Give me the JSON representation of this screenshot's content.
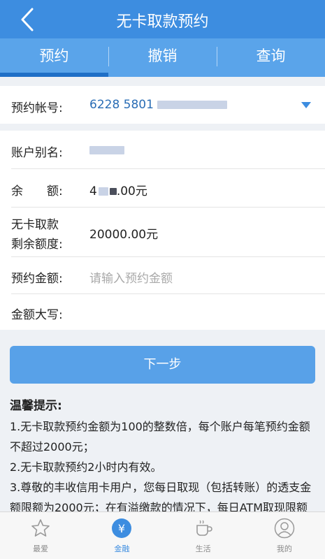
{
  "header": {
    "title": "无卡取款预约",
    "back_icon": "chevron-left-icon"
  },
  "tabs": [
    {
      "label": "预约",
      "active": true
    },
    {
      "label": "撤销",
      "active": false
    },
    {
      "label": "查询",
      "active": false
    }
  ],
  "form": {
    "account": {
      "label": "预约帐号:",
      "value": "6228 5801"
    },
    "alias": {
      "label": "账户别名:"
    },
    "balance": {
      "label": "余　　额:",
      "value_prefix": "4",
      "value_suffix": ".00元"
    },
    "cardless_limit": {
      "label_line1": "无卡取款",
      "label_line2": "剩余额度:",
      "value": "20000.00元"
    },
    "amount": {
      "label": "预约金额:",
      "placeholder": "请输入预约金额"
    },
    "amount_upper": {
      "label": "金额大写:",
      "value": ""
    }
  },
  "next_button": {
    "label": "下一步"
  },
  "tips": {
    "title": "温馨提示:",
    "lines": [
      "1.无卡取款预约金额为100的整数倍，每个账户每笔预约金额不超过2000元；",
      "2.无卡取款预约2小时内有效。",
      "3.尊敬的丰收信用卡用户，您每日取现（包括转账）的透支金额限额为2000元；在有溢缴款的情况下，每日ATM取现限额"
    ]
  },
  "bottom_nav": [
    {
      "label": "最爱",
      "icon": "star-icon",
      "active": false
    },
    {
      "label": "金融",
      "icon": "yen-icon",
      "active": true
    },
    {
      "label": "生活",
      "icon": "coffee-cup-icon",
      "active": false
    },
    {
      "label": "我的",
      "icon": "user-icon",
      "active": false
    }
  ],
  "colors": {
    "primary": "#3d8de0",
    "tab_bar": "#5aa4ea",
    "button": "#58a1e8",
    "account_text": "#2a6db5"
  }
}
